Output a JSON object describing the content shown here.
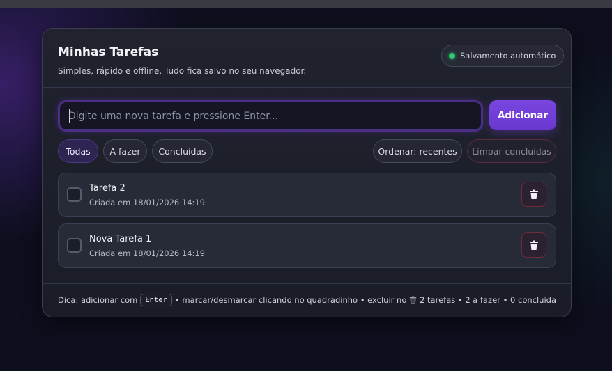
{
  "app": {
    "title": "Minhas Tarefas",
    "subtitle": "Simples, rápido e offline. Tudo fica salvo no seu navegador.",
    "autosave_label": "Salvamento automático"
  },
  "composer": {
    "placeholder": "Digite uma nova tarefa e pressione Enter...",
    "value": "",
    "add_label": "Adicionar"
  },
  "filters": [
    {
      "label": "Todas",
      "active": true
    },
    {
      "label": "A fazer",
      "active": false
    },
    {
      "label": "Concluídas",
      "active": false
    }
  ],
  "toolbar": {
    "sort_label": "Ordenar: recentes",
    "clear_label": "Limpar concluídas"
  },
  "tasks": [
    {
      "title": "Tarefa 2",
      "meta": "Criada em 18/01/2026 14:19",
      "done": false
    },
    {
      "title": "Nova Tarefa 1",
      "meta": "Criada em 18/01/2026 14:19",
      "done": false
    }
  ],
  "footer": {
    "tip_prefix": "Dica: adicionar com",
    "tip_key": "Enter",
    "tip_suffix": "• marcar/desmarcar clicando no quadradinho • excluir no",
    "stats": "2 tarefas • 2 a fazer • 0 concluída"
  },
  "colors": {
    "accent": "#7a45e0",
    "status_online": "#2ecc71",
    "danger": "#6a2e38"
  },
  "icons": {
    "delete": "trash-icon",
    "status": "status-dot-icon"
  }
}
